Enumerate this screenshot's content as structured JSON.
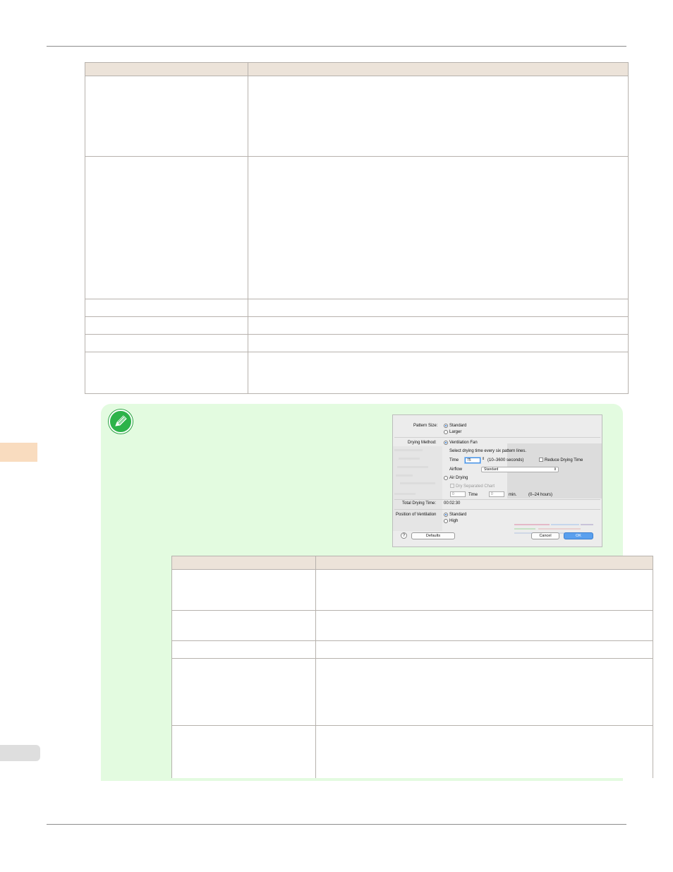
{
  "dialog": {
    "pattern_size_label": "Pattern Size:",
    "pattern_standard": "Standard",
    "pattern_larger": "Larger",
    "drying_method_label": "Drying Method:",
    "ventilation_fan": "Ventilation Fan",
    "select_drying_text": "Select drying time every six pattern lines.",
    "time_label": "Time",
    "time_value": "75",
    "time_range": "(10–3600 seconds)",
    "reduce_drying_time": "Reduce Drying Time",
    "airflow_label": "Airflow",
    "airflow_value": "Standard",
    "air_drying": "Air Drying",
    "dry_separated_chart": "Dry Separated Chart",
    "air_time_value_1": "0",
    "air_time_label": "Time",
    "air_time_value_2": "0",
    "min_label": "min.",
    "hours_range": "(0–24 hours)",
    "total_drying_time_label": "Total Drying Time:",
    "total_drying_time_value": "00:02:30",
    "position_ventilation_label": "Position of Ventilation",
    "position_standard": "Standard",
    "position_high": "High",
    "help_label": "?",
    "defaults_button": "Defaults",
    "cancel_button": "Cancel",
    "ok_button": "OK"
  },
  "colors": {
    "table_header": "#ece3d9",
    "note_background": "#e3fbe0",
    "note_icon": "#2db34a",
    "side_tab": "#f9dcbf"
  }
}
